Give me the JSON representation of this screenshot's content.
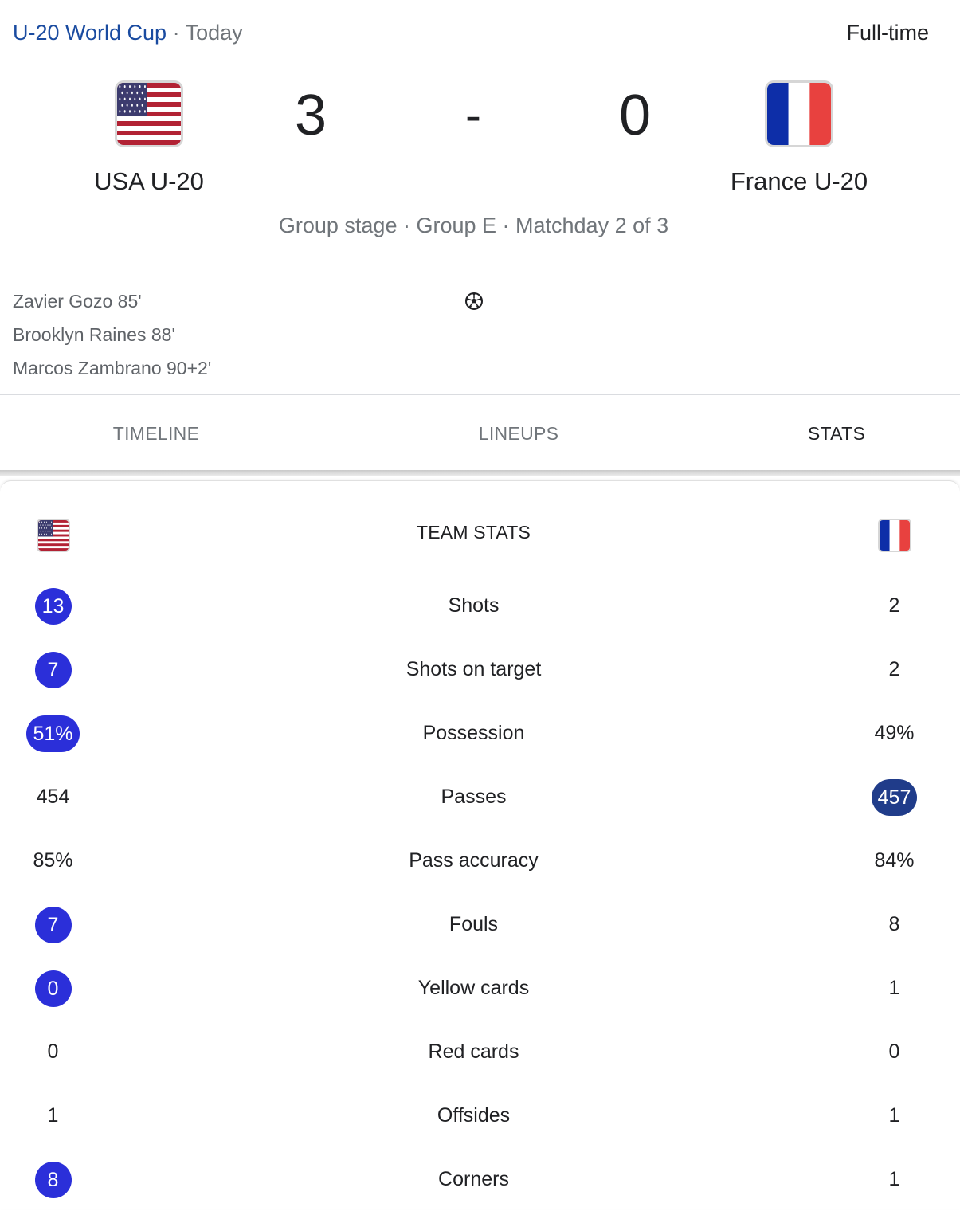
{
  "header": {
    "competition": "U-20 World Cup",
    "separator": "·",
    "date": "Today",
    "status": "Full-time"
  },
  "match": {
    "home": {
      "name": "USA U-20",
      "score": "3",
      "flag": "us-flag-icon"
    },
    "away": {
      "name": "France U-20",
      "score": "0",
      "flag": "france-flag-icon"
    },
    "score_separator": "-",
    "stage": "Group stage · Group E · Matchday 2 of 3"
  },
  "scorers": {
    "home": [
      "Zavier Gozo 85'",
      "Brooklyn Raines 88'",
      "Marcos Zambrano 90+2'"
    ],
    "icon": "soccer-ball-icon"
  },
  "tabs": [
    {
      "label": "TIMELINE",
      "active": false
    },
    {
      "label": "LINEUPS",
      "active": false
    },
    {
      "label": "STATS",
      "active": true
    }
  ],
  "team_stats": {
    "title": "TEAM STATS",
    "colors": {
      "home_highlight": "#2b2fd9",
      "away_highlight": "#203c8a"
    },
    "rows": [
      {
        "label": "Shots",
        "home": "13",
        "away": "2",
        "highlight": "home"
      },
      {
        "label": "Shots on target",
        "home": "7",
        "away": "2",
        "highlight": "home"
      },
      {
        "label": "Possession",
        "home": "51%",
        "away": "49%",
        "highlight": "home"
      },
      {
        "label": "Passes",
        "home": "454",
        "away": "457",
        "highlight": "away"
      },
      {
        "label": "Pass accuracy",
        "home": "85%",
        "away": "84%",
        "highlight": "none"
      },
      {
        "label": "Fouls",
        "home": "7",
        "away": "8",
        "highlight": "home"
      },
      {
        "label": "Yellow cards",
        "home": "0",
        "away": "1",
        "highlight": "home"
      },
      {
        "label": "Red cards",
        "home": "0",
        "away": "0",
        "highlight": "none"
      },
      {
        "label": "Offsides",
        "home": "1",
        "away": "1",
        "highlight": "none"
      },
      {
        "label": "Corners",
        "home": "8",
        "away": "1",
        "highlight": "home"
      }
    ]
  }
}
